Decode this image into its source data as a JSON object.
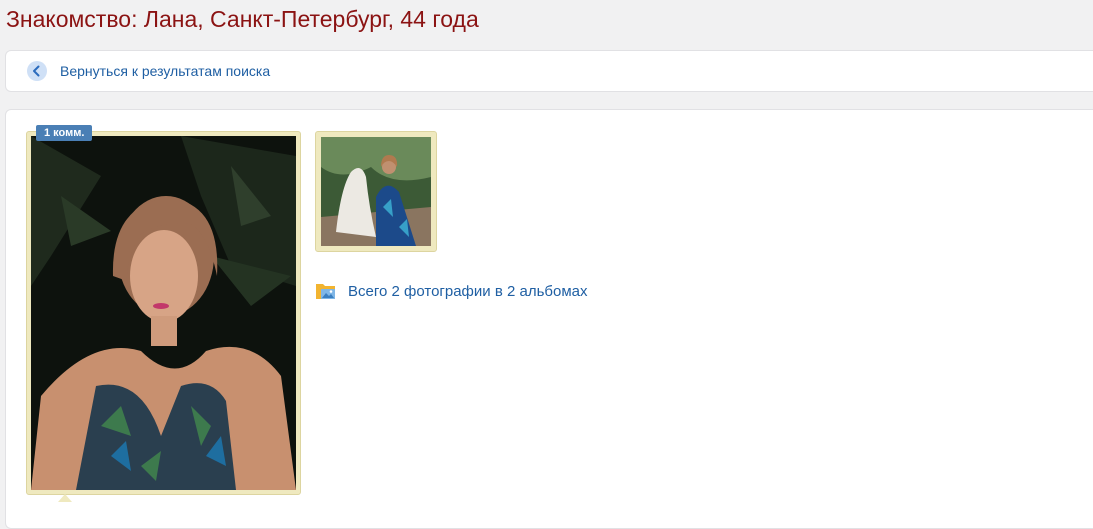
{
  "page": {
    "title": "Знакомство: Лана, Санкт-Петербург, 44 года"
  },
  "nav": {
    "back_label": "Вернуться к результатам поиска",
    "back_icon": "chevron-left-icon"
  },
  "profile": {
    "main_photo": {
      "comments_badge": "1 комм.",
      "subject": "woman-portrait"
    },
    "thumbnails": [
      {
        "subject": "woman-sitting-by-white-statue"
      }
    ],
    "albums_summary": "Всего 2 фотографии в 2 альбомах",
    "albums_icon": "folder-photo-icon"
  },
  "colors": {
    "title": "#8b1313",
    "link": "#1f5fa3",
    "photo_frame": "#efe9bf",
    "badge": "#4a7fb5",
    "background": "#f1f1f2"
  }
}
